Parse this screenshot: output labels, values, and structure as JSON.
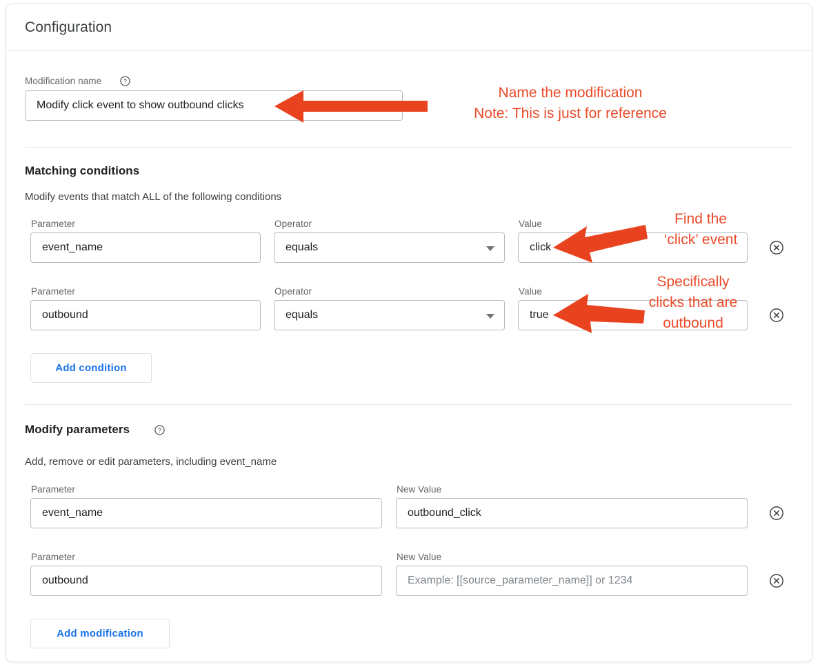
{
  "card": {
    "title": "Configuration"
  },
  "modification_name": {
    "label": "Modification name",
    "help_icon": "help-circle-icon",
    "value": "Modify click event to show outbound clicks"
  },
  "matching_conditions": {
    "title": "Matching conditions",
    "subtitle": "Modify events that match ALL of the following conditions",
    "column_labels": {
      "parameter": "Parameter",
      "operator": "Operator",
      "value": "Value"
    },
    "rows": [
      {
        "parameter": "event_name",
        "operator": "equals",
        "value": "click",
        "remove_icon": "remove-circle-icon"
      },
      {
        "parameter": "outbound",
        "operator": "equals",
        "value": "true",
        "remove_icon": "remove-circle-icon"
      }
    ],
    "add_button": "Add condition"
  },
  "modify_parameters": {
    "title": "Modify parameters",
    "help_icon": "help-circle-icon",
    "subtitle": "Add, remove or edit parameters, including event_name",
    "column_labels": {
      "parameter": "Parameter",
      "new_value": "New Value"
    },
    "rows": [
      {
        "parameter": "event_name",
        "new_value": "outbound_click",
        "new_value_placeholder": "",
        "remove_icon": "remove-circle-icon"
      },
      {
        "parameter": "outbound",
        "new_value": "",
        "new_value_placeholder": "Example: [[source_parameter_name]] or 1234",
        "remove_icon": "remove-circle-icon"
      }
    ],
    "add_button": "Add modification"
  },
  "annotations": {
    "color": "#ea4a28",
    "name_modification": "Name the modification\nNote: This is just for reference",
    "find_click_event": "Find the\n‘click’ event",
    "specifically_outbound": "Specifically clicks that are outbound"
  }
}
